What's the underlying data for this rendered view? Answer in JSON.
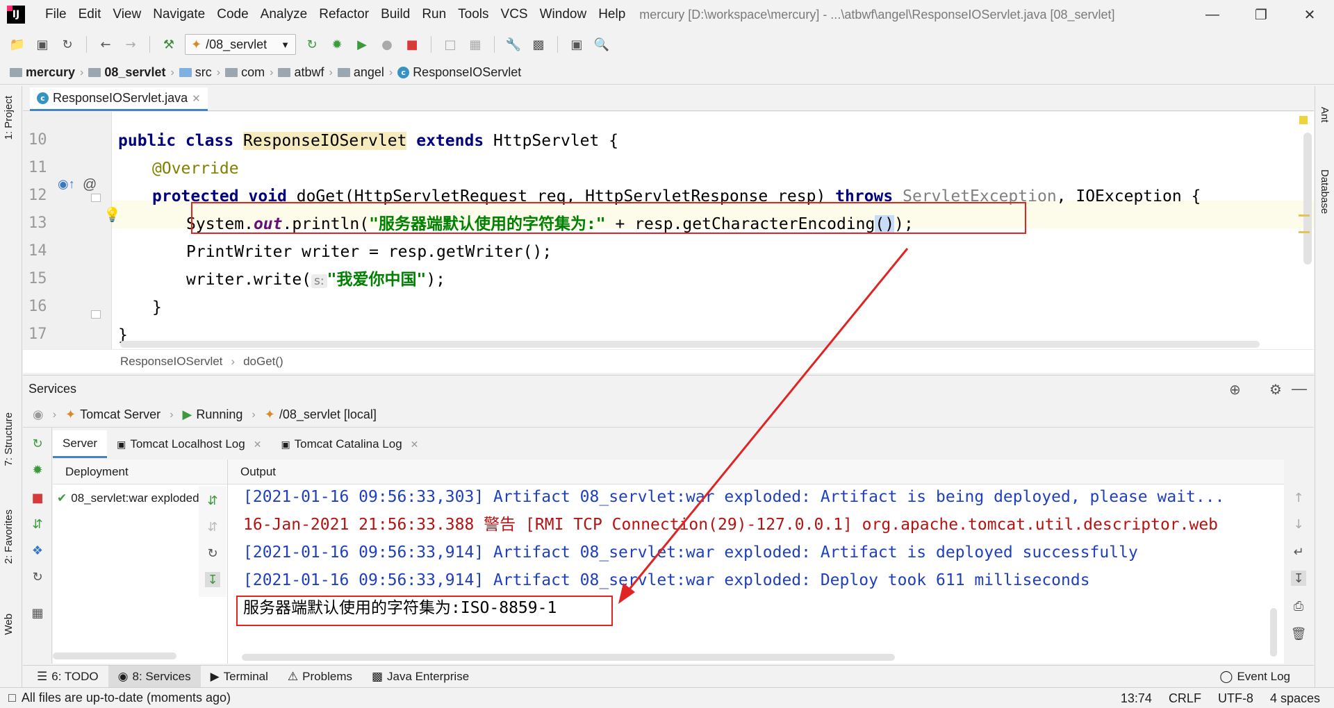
{
  "window": {
    "title": "mercury [D:\\workspace\\mercury] - ...\\atbwf\\angel\\ResponseIOServlet.java [08_servlet]",
    "menu": [
      "File",
      "Edit",
      "View",
      "Navigate",
      "Code",
      "Analyze",
      "Refactor",
      "Build",
      "Run",
      "Tools",
      "VCS",
      "Window",
      "Help"
    ]
  },
  "toolbar": {
    "run_config": "/08_servlet"
  },
  "breadcrumb": [
    "mercury",
    "08_servlet",
    "src",
    "com",
    "atbwf",
    "angel",
    "ResponseIOServlet"
  ],
  "left_tools": [
    "1: Project",
    "7: Structure",
    "2: Favorites",
    "Web"
  ],
  "right_tools": [
    "Ant",
    "Database"
  ],
  "editor": {
    "tab": "ResponseIOServlet.java",
    "line_numbers": [
      "10",
      "11",
      "12",
      "13",
      "14",
      "15",
      "16",
      "17"
    ],
    "lines": {
      "l10_kw1": "public class ",
      "l10_cls": "ResponseIOServlet",
      "l10_kw2": " extends ",
      "l10_rest": "HttpServlet {",
      "l11": "@Override",
      "l12_kw": "protected void ",
      "l12_a": "doGet(HttpServletRequest req, HttpServletResponse resp) ",
      "l12_throws": "throws ",
      "l12_ex": "ServletException",
      "l12_b": ", IOException {",
      "l13_a": "System.",
      "l13_out": "out",
      "l13_b": ".println(",
      "l13_str": "\"服务器端默认使用的字符集为:\"",
      "l13_c": " + resp.getCharacterEncoding",
      "l13_paren": "()",
      "l13_d": ");",
      "l14": "PrintWriter writer = resp.getWriter();",
      "l15_a": "writer.write(",
      "l15_hint": "s:",
      "l15_str": "\"我爱你中国\"",
      "l15_b": ");",
      "l16": "}",
      "l17": "}"
    },
    "crumb_class": "ResponseIOServlet",
    "crumb_method": "doGet()"
  },
  "services": {
    "title": "Services",
    "path": [
      "Tomcat Server",
      "Running",
      "/08_servlet [local]"
    ],
    "tabs": [
      "Server",
      "Tomcat Localhost Log",
      "Tomcat Catalina Log"
    ],
    "deployment_header": "Deployment",
    "deployment_item": "08_servlet:war exploded",
    "output_header": "Output",
    "output_lines": [
      "[2021-01-16 09:56:33,303] Artifact 08_servlet:war exploded: Artifact is being deployed, please wait...",
      "16-Jan-2021 21:56:33.388 警告 [RMI TCP Connection(29)-127.0.0.1] org.apache.tomcat.util.descriptor.web",
      "[2021-01-16 09:56:33,914] Artifact 08_servlet:war exploded: Artifact is deployed successfully",
      "[2021-01-16 09:56:33,914] Artifact 08_servlet:war exploded: Deploy took 611 milliseconds",
      "服务器端默认使用的字符集为:ISO-8859-1"
    ]
  },
  "bottom_tabs": [
    "6: TODO",
    "8: Services",
    "Terminal",
    "Problems",
    "Java Enterprise"
  ],
  "event_log": "Event Log",
  "status": {
    "message": "All files are up-to-date (moments ago)",
    "position": "13:74",
    "line_sep": "CRLF",
    "encoding": "UTF-8",
    "indent": "4 spaces"
  },
  "colors": {
    "annotation_box": "#e02323",
    "arrow": "#e02323",
    "accent": "#4083c9"
  }
}
